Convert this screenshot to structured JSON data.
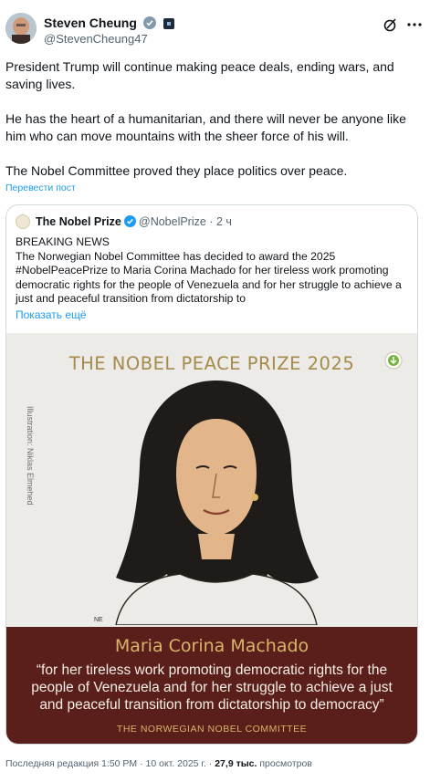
{
  "post": {
    "author_name": "Steven Cheung",
    "author_handle": "@StevenCheung47",
    "paragraphs": [
      "President Trump will continue making peace deals, ending wars, and saving lives.",
      "He has the heart of a humanitarian, and there will never be anyone like him who can move mountains with the sheer force of his will.",
      "The Nobel Committee proved they place politics over peace."
    ],
    "translate_label": "Перевести пост"
  },
  "quote": {
    "name": "The Nobel Prize",
    "handle": "@NobelPrize",
    "time": "· 2 ч",
    "text_lines": [
      "BREAKING NEWS",
      "The Norwegian Nobel Committee has decided to award the 2025",
      "#NobelPeacePrize to Maria Corina Machado for her tireless work promoting",
      "democratic rights for the people of Venezuela and for her struggle to achieve a",
      "just and peaceful transition from dictatorship to"
    ],
    "show_more": "Показать ещё"
  },
  "image": {
    "title": "THE NOBEL PEACE PRIZE 2025",
    "credit": "Illustration: Niklas Elmehed",
    "signature": "NE",
    "laureate": "Maria Corina Machado",
    "citation_lines": [
      "“for her tireless work promoting democratic rights for the",
      "people of Venezuela and for her struggle to achieve a just",
      "and peaceful transition from dictatorship to democracy”"
    ],
    "committee": "THE NORWEGIAN NOBEL COMMITTEE"
  },
  "meta": {
    "edited": "Последняя редакция 1:50 PM · 10 окт. 2025 г. ·",
    "views_count": "27,9 тыс.",
    "views_label": "просмотров"
  },
  "colors": {
    "accent": "#1d9bf0",
    "gold": "#a58a4a",
    "banner": "#5a1e1b",
    "banner_gold": "#d8b56a"
  },
  "icons": [
    "verified-badge-icon",
    "affiliate-badge-icon",
    "grok-icon",
    "more-options-icon",
    "download-icon"
  ]
}
